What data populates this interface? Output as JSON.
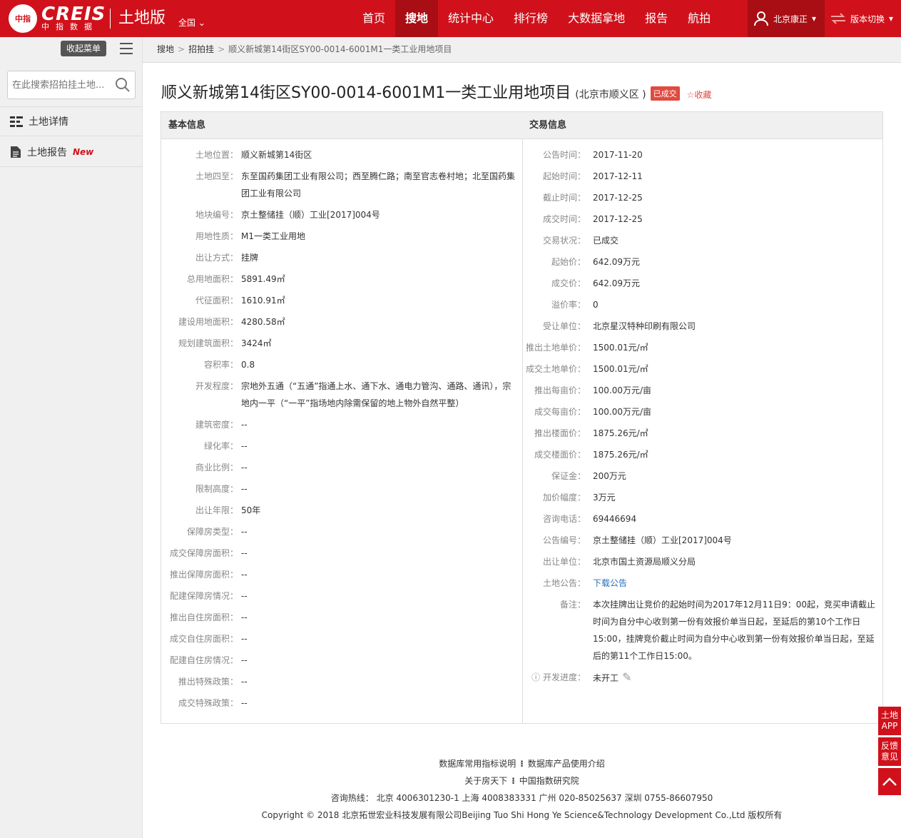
{
  "header": {
    "logo_text": "中指",
    "brand": "CREIS",
    "brand_sub": "中指数据",
    "edition": "土地版",
    "region": "全国",
    "nav": [
      "首页",
      "搜地",
      "统计中心",
      "排行榜",
      "大数据拿地",
      "报告",
      "航拍"
    ],
    "active_nav": "搜地",
    "user": "北京康正",
    "switch_label": "版本切换"
  },
  "sidebar": {
    "collapse_label": "收起菜单",
    "search_placeholder": "在此搜索招拍挂土地...",
    "items": [
      {
        "label": "土地详情",
        "icon": "list-icon"
      },
      {
        "label": "土地报告",
        "badge": "New",
        "icon": "document-icon"
      }
    ]
  },
  "breadcrumb": {
    "items": [
      "搜地",
      "招拍挂",
      "顺义新城第14街区SY00-0014-6001M1一类工业用地项目"
    ]
  },
  "title": {
    "main": "顺义新城第14街区SY00-0014-6001M1一类工业用地项目",
    "location": "(北京市顺义区 )",
    "status": "已成交",
    "favorite": "收藏"
  },
  "basic": {
    "heading": "基本信息",
    "rows": [
      {
        "label": "土地位置：",
        "value": "顺义新城第14街区"
      },
      {
        "label": "土地四至：",
        "value": "东至国药集团工业有限公司；西至腾仁路；南至官志卷村地；北至国药集团工业有限公司"
      },
      {
        "label": "地块编号：",
        "value": "京土整储挂（顺）工业[2017]004号"
      },
      {
        "label": "用地性质：",
        "value": "M1一类工业用地"
      },
      {
        "label": "出让方式：",
        "value": "挂牌"
      },
      {
        "label": "总用地面积：",
        "value": "5891.49㎡"
      },
      {
        "label": "代征面积：",
        "value": "1610.91㎡"
      },
      {
        "label": "建设用地面积：",
        "value": "4280.58㎡"
      },
      {
        "label": "规划建筑面积：",
        "value": "3424㎡"
      },
      {
        "label": "容积率：",
        "value": "0.8"
      },
      {
        "label": "开发程度：",
        "value": "宗地外五通（“五通”指通上水、通下水、通电力管沟、通路、通讯），宗地内一平（“一平”指场地内除需保留的地上物外自然平整）"
      },
      {
        "label": "建筑密度：",
        "value": "--"
      },
      {
        "label": "绿化率：",
        "value": "--"
      },
      {
        "label": "商业比例：",
        "value": "--"
      },
      {
        "label": "限制高度：",
        "value": "--"
      },
      {
        "label": "出让年限：",
        "value": "50年"
      },
      {
        "label": "保障房类型：",
        "value": "--"
      },
      {
        "label": "成交保障房面积：",
        "value": "--"
      },
      {
        "label": "推出保障房面积：",
        "value": "--"
      },
      {
        "label": "配建保障房情况：",
        "value": "--"
      },
      {
        "label": "推出自住房面积：",
        "value": "--"
      },
      {
        "label": "成交自住房面积：",
        "value": "--"
      },
      {
        "label": "配建自住房情况：",
        "value": "--"
      },
      {
        "label": "推出特殊政策：",
        "value": "--"
      },
      {
        "label": "成交特殊政策：",
        "value": "--"
      }
    ]
  },
  "trade": {
    "heading": "交易信息",
    "rows": [
      {
        "label": "公告时间：",
        "value": "2017-11-20"
      },
      {
        "label": "起始时间：",
        "value": "2017-12-11"
      },
      {
        "label": "截止时间：",
        "value": "2017-12-25"
      },
      {
        "label": "成交时间：",
        "value": "2017-12-25"
      },
      {
        "label": "交易状况：",
        "value": "已成交"
      },
      {
        "label": "起始价：",
        "value": "642.09万元"
      },
      {
        "label": "成交价：",
        "value": "642.09万元"
      },
      {
        "label": "溢价率：",
        "value": "0"
      },
      {
        "label": "受让单位：",
        "value": "北京星汉特种印刷有限公司"
      },
      {
        "label": "推出土地单价：",
        "value": "1500.01元/㎡"
      },
      {
        "label": "成交土地单价：",
        "value": "1500.01元/㎡"
      },
      {
        "label": "推出每亩价：",
        "value": "100.00万元/亩"
      },
      {
        "label": "成交每亩价：",
        "value": "100.00万元/亩"
      },
      {
        "label": "推出楼面价：",
        "value": "1875.26元/㎡"
      },
      {
        "label": "成交楼面价：",
        "value": "1875.26元/㎡"
      },
      {
        "label": "保证金：",
        "value": "200万元"
      },
      {
        "label": "加价幅度：",
        "value": "3万元"
      },
      {
        "label": "咨询电话：",
        "value": "69446694"
      },
      {
        "label": "公告编号：",
        "value": "京土整储挂（顺）工业[2017]004号"
      },
      {
        "label": "出让单位：",
        "value": "北京市国土资源局顺义分局"
      },
      {
        "label": "土地公告：",
        "value": "下载公告",
        "link": true
      },
      {
        "label": "备注：",
        "value": "本次挂牌出让竞价的起始时间为2017年12月11日9：00起，竞买申请截止时间为自分中心收到第一份有效报价单当日起，至延后的第10个工作日15:00，挂牌竞价截止时间为自分中心收到第一份有效报价单当日起，至延后的第11个工作日15:00。"
      },
      {
        "label": "开发进度：",
        "value": "未开工",
        "info": true
      }
    ]
  },
  "footer": {
    "line1": [
      "数据库常用指标说明",
      "数据库产品使用介绍"
    ],
    "line2": [
      "关于房天下",
      "中国指数研究院"
    ],
    "hotline": "咨询热线： 北京 4006301230-1 上海 4008383331 广州 020-85025637 深圳 0755-86607950",
    "copyright": "Copyright © 2018 北京拓世宏业科技发展有限公司Beijing Tuo Shi Hong Ye Science&Technology Development Co.,Ltd 版权所有"
  },
  "float_buttons": [
    "土地APP",
    "反馈意见"
  ],
  "colors": {
    "brand_red": "#d0111b",
    "dark_red": "#a80e14",
    "badge_red": "#e04a3f",
    "link_blue": "#2a6fb8"
  }
}
